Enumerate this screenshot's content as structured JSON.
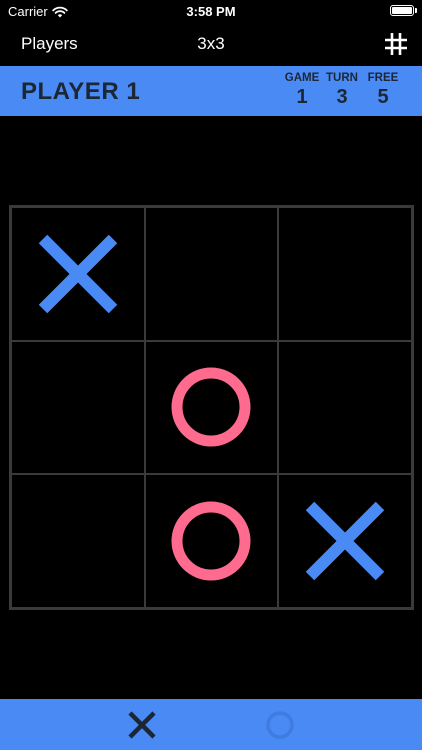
{
  "status_bar": {
    "carrier": "Carrier",
    "time": "3:58 PM"
  },
  "nav": {
    "left_label": "Players",
    "title": "3x3",
    "right_icon": "grid-hash-icon"
  },
  "banner": {
    "player": "PLAYER 1",
    "stats": [
      {
        "label": "GAME",
        "value": "1"
      },
      {
        "label": "TURN",
        "value": "3"
      },
      {
        "label": "FREE",
        "value": "5"
      }
    ]
  },
  "board": {
    "cells": [
      "X",
      "",
      "",
      "",
      "O",
      "",
      "",
      "O",
      "X"
    ]
  },
  "bottom_bar": {
    "x_icon": "x-mark-icon",
    "o_icon": "o-mark-icon"
  },
  "colors": {
    "accent": "#4a8af4",
    "x": "#4a8af4",
    "o": "#ff6b8f",
    "dark": "#1c2736",
    "grid": "#3a3a3a"
  }
}
